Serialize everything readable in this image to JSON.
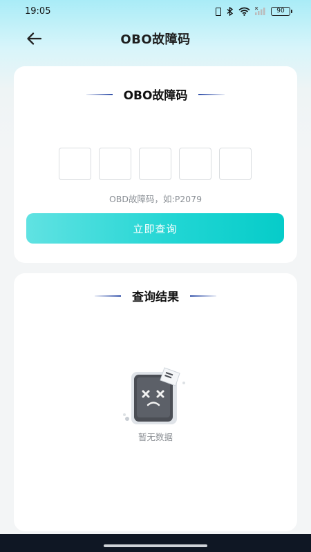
{
  "status_bar": {
    "time": "19:05",
    "battery": "90",
    "icons": [
      "vibrate-icon",
      "bluetooth-icon",
      "wifi-icon",
      "signal-icon",
      "battery-icon"
    ]
  },
  "header": {
    "title": "OBO故障码",
    "back_icon": "arrow-left-icon"
  },
  "query_card": {
    "title": "OBO故障码",
    "code_boxes": [
      "",
      "",
      "",
      "",
      ""
    ],
    "hint": "OBD故障码，如:P2079",
    "button_label": "立即查询"
  },
  "result_card": {
    "title": "查询结果",
    "empty_text": "暂无数据",
    "empty_icon": "sad-document-icon"
  },
  "colors": {
    "accent": "#1fd5d3",
    "title_line": "#2f4ea8",
    "hint_text": "#8a8f95"
  }
}
